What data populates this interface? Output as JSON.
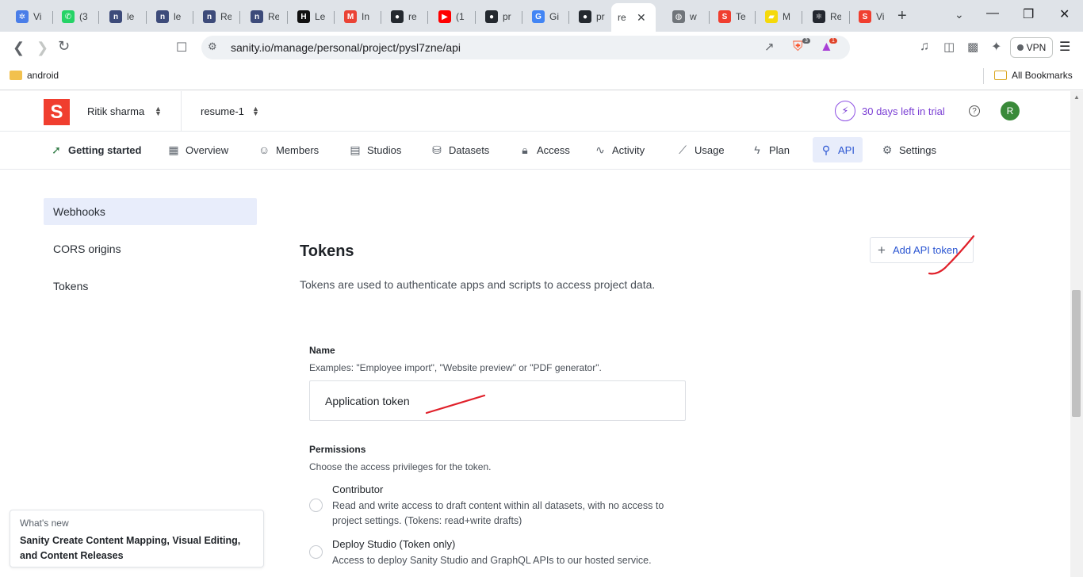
{
  "browser": {
    "tabs": [
      {
        "label": "Vi",
        "icon": "snowflake-icon",
        "color": "#4a7ee8"
      },
      {
        "label": "(3",
        "icon": "whatsapp-icon",
        "color": "#25d366"
      },
      {
        "label": "le",
        "icon": "naukri-icon",
        "color": "#3d4b7a"
      },
      {
        "label": "le",
        "icon": "naukri-icon",
        "color": "#3d4b7a"
      },
      {
        "label": "Re",
        "icon": "naukri-icon",
        "color": "#3d4b7a"
      },
      {
        "label": "Re",
        "icon": "naukri-icon",
        "color": "#3d4b7a"
      },
      {
        "label": "Le",
        "icon": "hackerrank-icon",
        "color": "#111111"
      },
      {
        "label": "In",
        "icon": "gmail-icon",
        "color": "#ea4335"
      },
      {
        "label": "re",
        "icon": "github-icon",
        "color": "#24292f"
      },
      {
        "label": "(1",
        "icon": "youtube-icon",
        "color": "#ff0000"
      },
      {
        "label": "pr",
        "icon": "github-icon",
        "color": "#24292f"
      },
      {
        "label": "Gi",
        "icon": "google-icon",
        "color": "#4285f4"
      },
      {
        "label": "pr",
        "icon": "github-icon",
        "color": "#24292f"
      },
      {
        "label": "re",
        "icon": "sanity-icon",
        "color": "#f03e2f"
      },
      {
        "label": "w",
        "icon": "globe-icon",
        "color": "#70757a"
      },
      {
        "label": "Te",
        "icon": "sanity-icon",
        "color": "#f03e2f"
      },
      {
        "label": "M",
        "icon": "brand-icon",
        "color": "#f5d90a"
      },
      {
        "label": "Re",
        "icon": "react-icon",
        "color": "#23272f"
      },
      {
        "label": "Vi",
        "icon": "sanity-icon",
        "color": "#f03e2f"
      }
    ],
    "active_tab_label": "re",
    "url": "sanity.io/manage/personal/project/pysl7zne/api",
    "brave_badge": "3",
    "alert_badge": "1",
    "vpn_label": "VPN",
    "bookmark_folder": "android",
    "all_bookmarks": "All Bookmarks"
  },
  "app": {
    "logo_letter": "S",
    "org_name": "Ritik sharma",
    "project_name": "resume-1",
    "trial_text": "30 days left in trial",
    "avatar_initial": "R",
    "nav": [
      {
        "label": "Getting started",
        "icon": "rocket-icon"
      },
      {
        "label": "Overview",
        "icon": "overview-icon"
      },
      {
        "label": "Members",
        "icon": "members-icon"
      },
      {
        "label": "Studios",
        "icon": "studios-icon"
      },
      {
        "label": "Datasets",
        "icon": "datasets-icon"
      },
      {
        "label": "Access",
        "icon": "lock-icon"
      },
      {
        "label": "Activity",
        "icon": "activity-icon"
      },
      {
        "label": "Usage",
        "icon": "chart-icon"
      },
      {
        "label": "Plan",
        "icon": "bolt-icon"
      },
      {
        "label": "API",
        "icon": "plug-icon"
      },
      {
        "label": "Settings",
        "icon": "gear-icon"
      }
    ],
    "active_nav": "API",
    "sidebar": [
      {
        "label": "Webhooks"
      },
      {
        "label": "CORS origins"
      },
      {
        "label": "Tokens"
      }
    ],
    "active_sidebar": "Webhooks"
  },
  "tokens": {
    "title": "Tokens",
    "description": "Tokens are used to authenticate apps and scripts to access project data.",
    "add_button": "Add API token",
    "name_label": "Name",
    "name_help": "Examples: \"Employee import\", \"Website preview\" or \"PDF generator\".",
    "name_value": "Application token",
    "permissions_label": "Permissions",
    "permissions_help": "Choose the access privileges for the token.",
    "permissions": [
      {
        "title": "Contributor",
        "desc": "Read and write access to draft content within all datasets, with no access to project settings. (Tokens: read+write drafts)"
      },
      {
        "title": "Deploy Studio (Token only)",
        "desc": "Access to deploy Sanity Studio and GraphQL APIs to our hosted service."
      }
    ]
  },
  "whats_new": {
    "label": "What's new",
    "text": "Sanity Create Content Mapping, Visual Editing, and Content Releases"
  },
  "colors": {
    "accent": "#2a55d2",
    "brand": "#f03e2f",
    "trial": "#7b3fd4",
    "annotation": "#e0202a"
  }
}
